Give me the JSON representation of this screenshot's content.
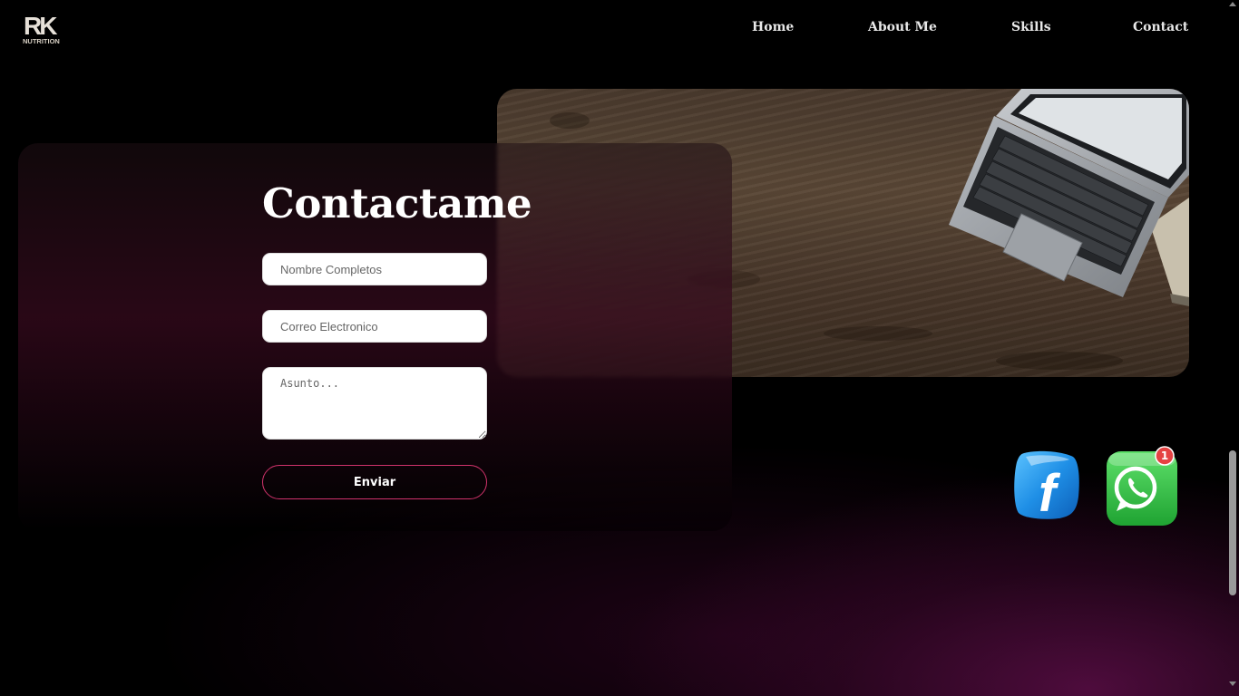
{
  "header": {
    "logo_text": "RK",
    "logo_subtext": "NUTRITION",
    "nav": [
      {
        "label": "Home"
      },
      {
        "label": "About Me"
      },
      {
        "label": "Skills"
      },
      {
        "label": "Contact"
      }
    ]
  },
  "contact": {
    "title": "Contactame",
    "name_placeholder": "Nombre Completos",
    "email_placeholder": "Correo Electronico",
    "message_placeholder": "Asunto...",
    "submit_label": "Enviar"
  },
  "hero": {
    "image": "wooden-desk-with-laptop"
  },
  "social": {
    "facebook": {
      "icon": "facebook-icon"
    },
    "whatsapp": {
      "icon": "whatsapp-icon",
      "notification_count": "1"
    }
  },
  "colors": {
    "accent": "#d0336b",
    "background": "#000000",
    "whatsapp_green": "#2fbd45",
    "facebook_blue": "#1f8fe6"
  }
}
